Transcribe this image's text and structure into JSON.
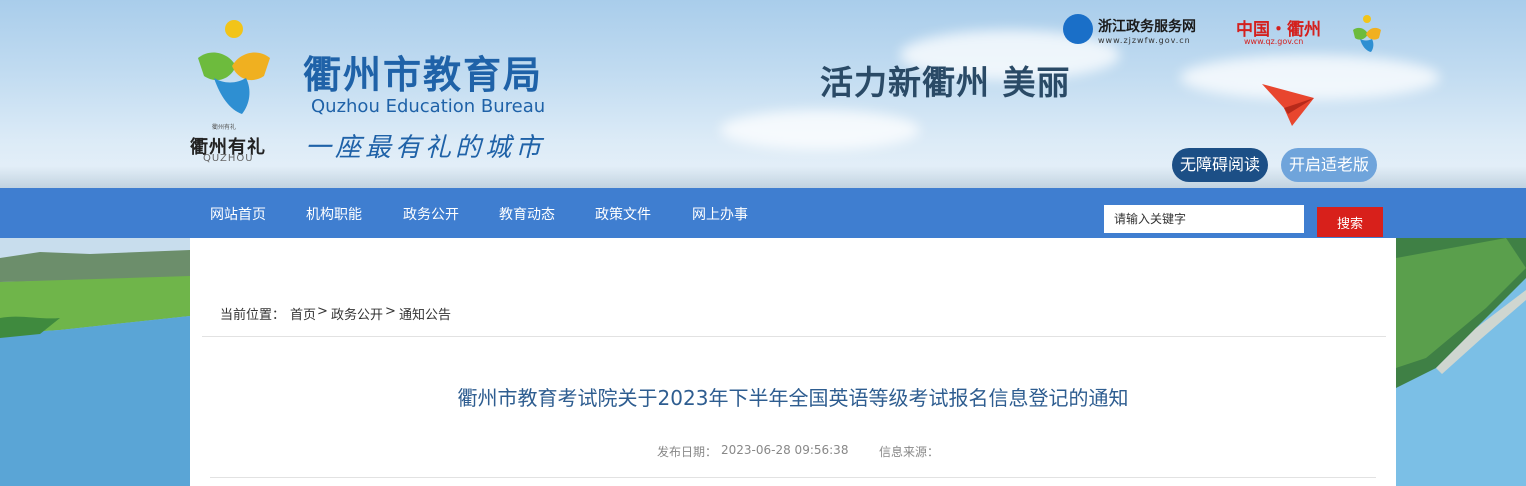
{
  "header": {
    "emblem_caption": "衢州有礼",
    "emblem_pinyin": "QUZHOU",
    "bureau_name_cn": "衢州市教育局",
    "bureau_name_en": "Quzhou Education Bureau",
    "bureau_slogan": "一座最有礼的城市",
    "banner_slogan": "活力新衢州  美丽",
    "partners": {
      "zhejiang_name": "浙江政务服务网",
      "zhejiang_url": "www.zjzwfw.gov.cn",
      "quzhou_name": "中国・衢州",
      "quzhou_url": "www.qz.gov.cn"
    },
    "accessible_label": "无障碍阅读",
    "elder_label": "开启适老版"
  },
  "nav": {
    "items": [
      "网站首页",
      "机构职能",
      "政务公开",
      "教育动态",
      "政策文件",
      "网上办事"
    ]
  },
  "search": {
    "placeholder": "请输入关键字",
    "button_label": "搜索"
  },
  "breadcrumb": {
    "label": "当前位置：",
    "items": [
      "首页",
      "政务公开",
      "通知公告"
    ],
    "separator": ">"
  },
  "article": {
    "title": "衢州市教育考试院关于2023年下半年全国英语等级考试报名信息登记的通知",
    "publish_label": "发布日期：",
    "publish_date": "2023-06-28 09:56:38",
    "source_label": "信息来源："
  },
  "colors": {
    "nav_bg": "#3f7ed0",
    "search_button": "#d8201b",
    "title_text": "#2e5d90",
    "accessible_pill": "#1c4f86",
    "elder_pill": "#6fa4db"
  }
}
